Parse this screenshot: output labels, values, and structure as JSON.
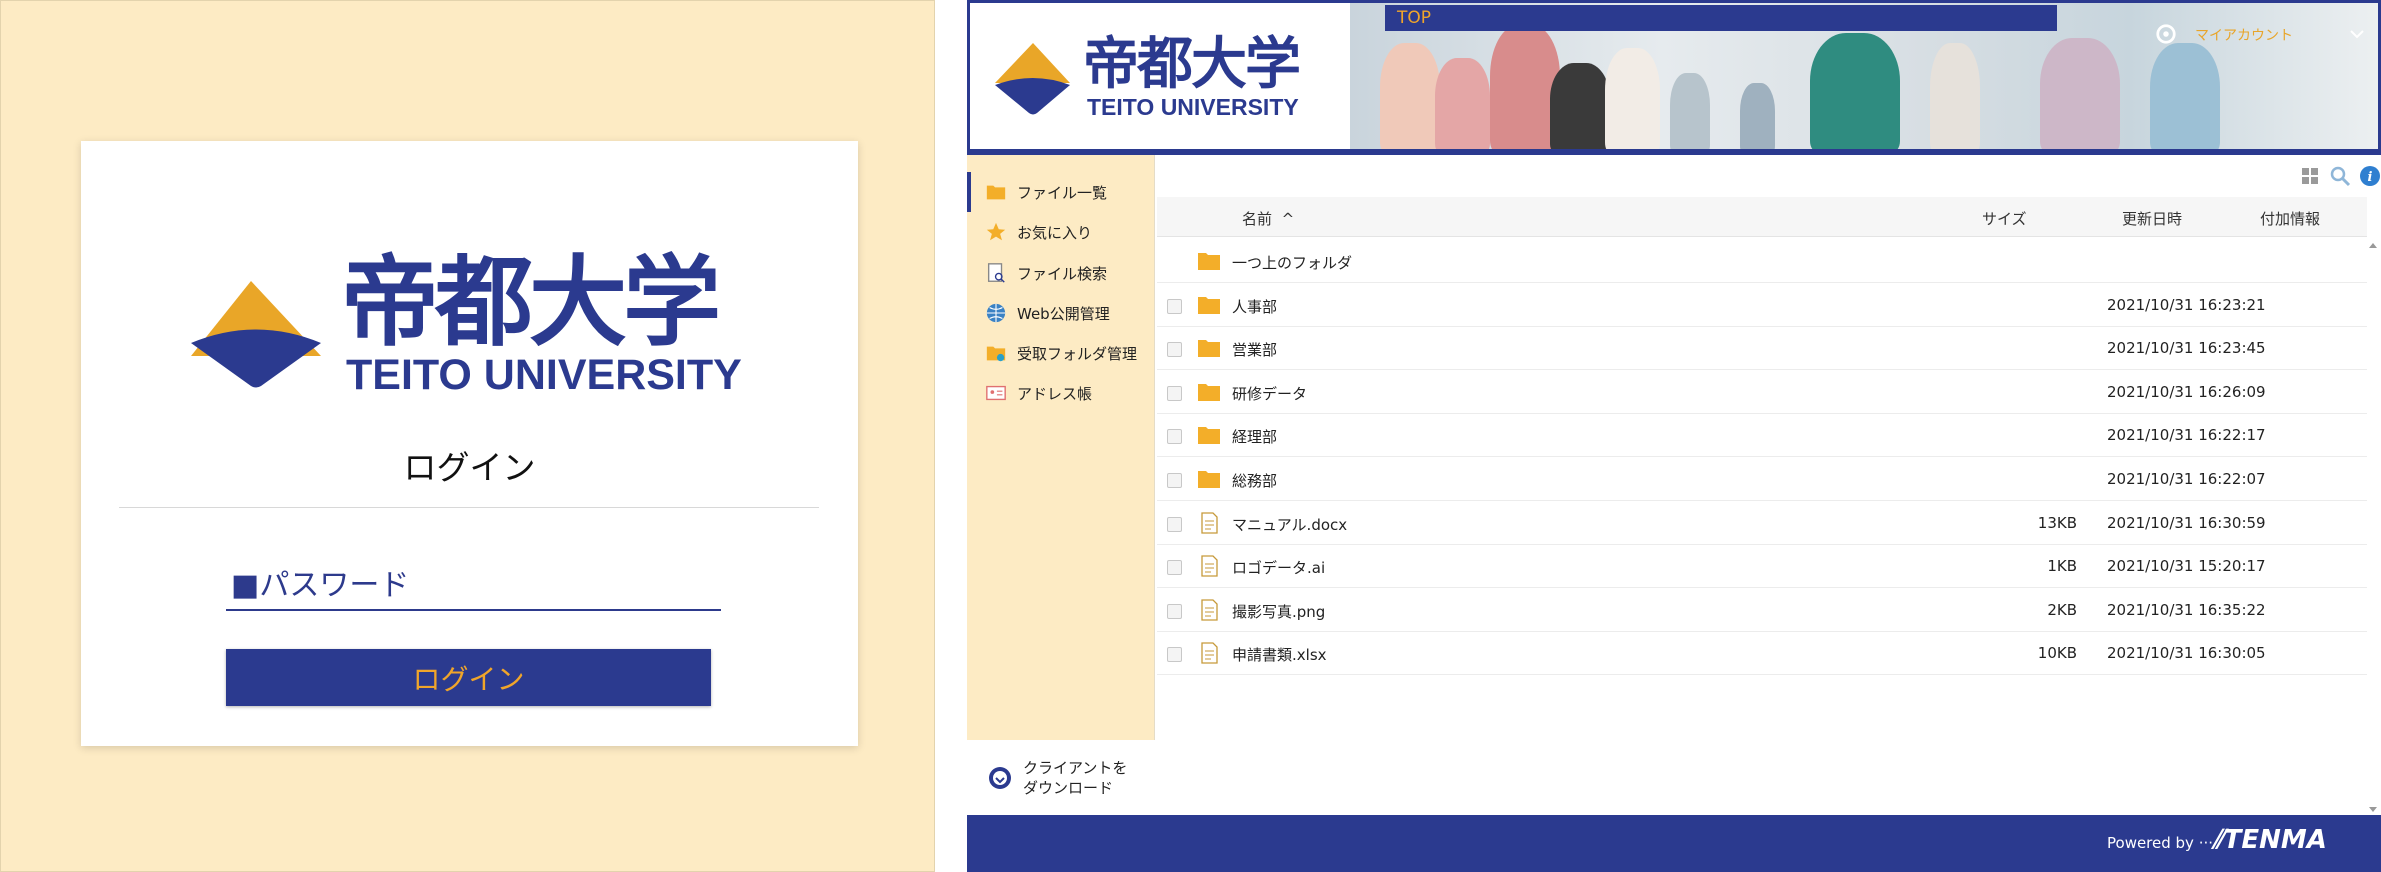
{
  "login": {
    "logo_kanji": "帝都大学",
    "logo_english": "TEITO UNIVERSITY",
    "title": "ログイン",
    "password_placeholder": "■パスワード",
    "button_label": "ログイン"
  },
  "header": {
    "logo_kanji": "帝都大学",
    "logo_english": "TEITO UNIVERSITY",
    "banner_label": "TOP",
    "account_label": "マイアカウント"
  },
  "sidebar": {
    "items": [
      {
        "label": "ファイル一覧",
        "icon": "folder-icon"
      },
      {
        "label": "お気に入り",
        "icon": "star-icon"
      },
      {
        "label": "ファイル検索",
        "icon": "file-search-icon"
      },
      {
        "label": "Web公開管理",
        "icon": "globe-icon"
      },
      {
        "label": "受取フォルダ管理",
        "icon": "inbox-folder-icon"
      },
      {
        "label": "アドレス帳",
        "icon": "address-book-icon"
      }
    ],
    "download_line1": "クライアントを",
    "download_line2": "ダウンロード"
  },
  "table": {
    "col_name": "名前",
    "col_size": "サイズ",
    "col_date": "更新日時",
    "col_info": "付加情報",
    "up_folder": "一つ上のフォルダ",
    "rows": [
      {
        "name": "人事部",
        "type": "folder",
        "size": "",
        "date": "2021/10/31 16:23:21"
      },
      {
        "name": "営業部",
        "type": "folder",
        "size": "",
        "date": "2021/10/31 16:23:45"
      },
      {
        "name": "研修データ",
        "type": "folder",
        "size": "",
        "date": "2021/10/31 16:26:09"
      },
      {
        "name": "経理部",
        "type": "folder",
        "size": "",
        "date": "2021/10/31 16:22:17"
      },
      {
        "name": "総務部",
        "type": "folder",
        "size": "",
        "date": "2021/10/31 16:22:07"
      },
      {
        "name": "マニュアル.docx",
        "type": "file",
        "size": "13KB",
        "date": "2021/10/31 16:30:59"
      },
      {
        "name": "ロゴデータ.ai",
        "type": "file",
        "size": "1KB",
        "date": "2021/10/31 15:20:17"
      },
      {
        "name": "撮影写真.png",
        "type": "file",
        "size": "2KB",
        "date": "2021/10/31 16:35:22"
      },
      {
        "name": "申請書類.xlsx",
        "type": "file",
        "size": "10KB",
        "date": "2021/10/31 16:30:05"
      }
    ]
  },
  "footer": {
    "powered_by": "Powered by ···",
    "brand": "TENMA"
  },
  "colors": {
    "navy": "#2b3a8f",
    "gold": "#f0a52a",
    "cream": "#fdebc4"
  }
}
